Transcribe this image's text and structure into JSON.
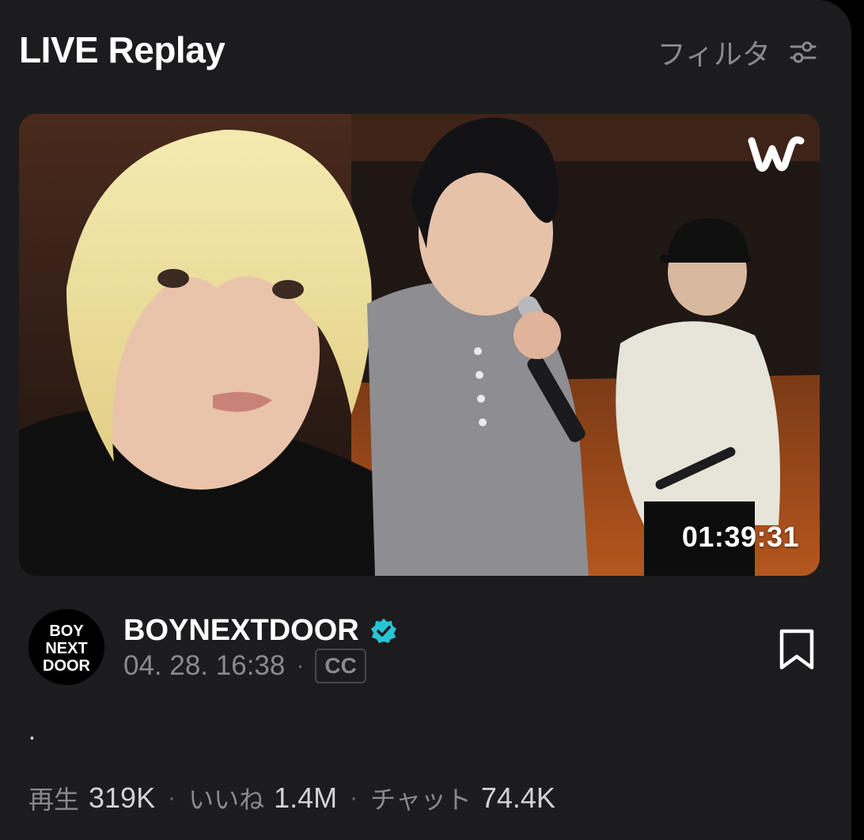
{
  "header": {
    "title": "LIVE Replay",
    "filter_label": "フィルタ"
  },
  "video": {
    "duration": "01:39:31",
    "platform_logo": "w"
  },
  "channel": {
    "name": "BOYNEXTDOOR",
    "avatar_text_line1": "BOY",
    "avatar_text_line2": "NEXT",
    "avatar_text_line3": "DOOR",
    "verified": true,
    "date": "04. 28. 16:38",
    "separator": "·",
    "cc_label": "CC"
  },
  "description": ".",
  "stats": {
    "plays_label": "再生",
    "plays_value": "319K",
    "likes_label": "いいね",
    "likes_value": "1.4M",
    "chat_label": "チャット",
    "chat_value": "74.4K",
    "separator": "·"
  },
  "colors": {
    "background": "#1c1c1e",
    "verified_badge": "#29c4d4",
    "muted_text": "#8a8a8e"
  },
  "icons": {
    "filter": "sliders-icon",
    "verified": "verified-badge-icon",
    "bookmark": "bookmark-icon"
  }
}
